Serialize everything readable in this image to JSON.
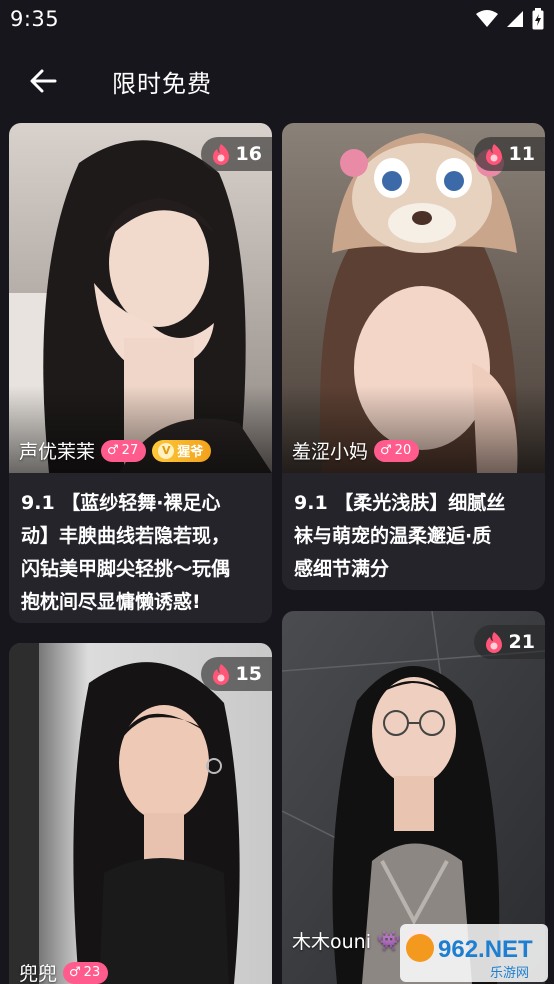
{
  "status_bar": {
    "time": "9:35"
  },
  "header": {
    "title": "限时免费"
  },
  "cards": [
    {
      "count": "16",
      "name": "声优茉茉",
      "level": "27",
      "vip_label": "猩爷",
      "desc_lines": [
        "9.1 【蓝纱轻舞·裸足心",
        "动】丰腴曲线若隐若现，",
        "闪钻美甲脚尖轻挑～玩偶",
        "抱枕间尽显慵懒诱惑!"
      ]
    },
    {
      "count": "11",
      "name": "羞涩小妈",
      "level": "20",
      "desc_lines": [
        "9.1 【柔光浅肤】细腻丝",
        "袜与萌宠的温柔邂逅·质",
        "感细节满分"
      ]
    },
    {
      "count": "15",
      "name": "兜兜",
      "level": "23"
    },
    {
      "count": "21",
      "name": "木木ouni",
      "name_emoji": "👾"
    }
  ],
  "watermark": {
    "text": "962.NET",
    "sub": "乐游网"
  },
  "colors": {
    "background": "#17161c",
    "card": "#25242b",
    "level_pill": "#ff5c8d",
    "vip_pill": "#f5b12a",
    "flame": "#ff5577"
  }
}
